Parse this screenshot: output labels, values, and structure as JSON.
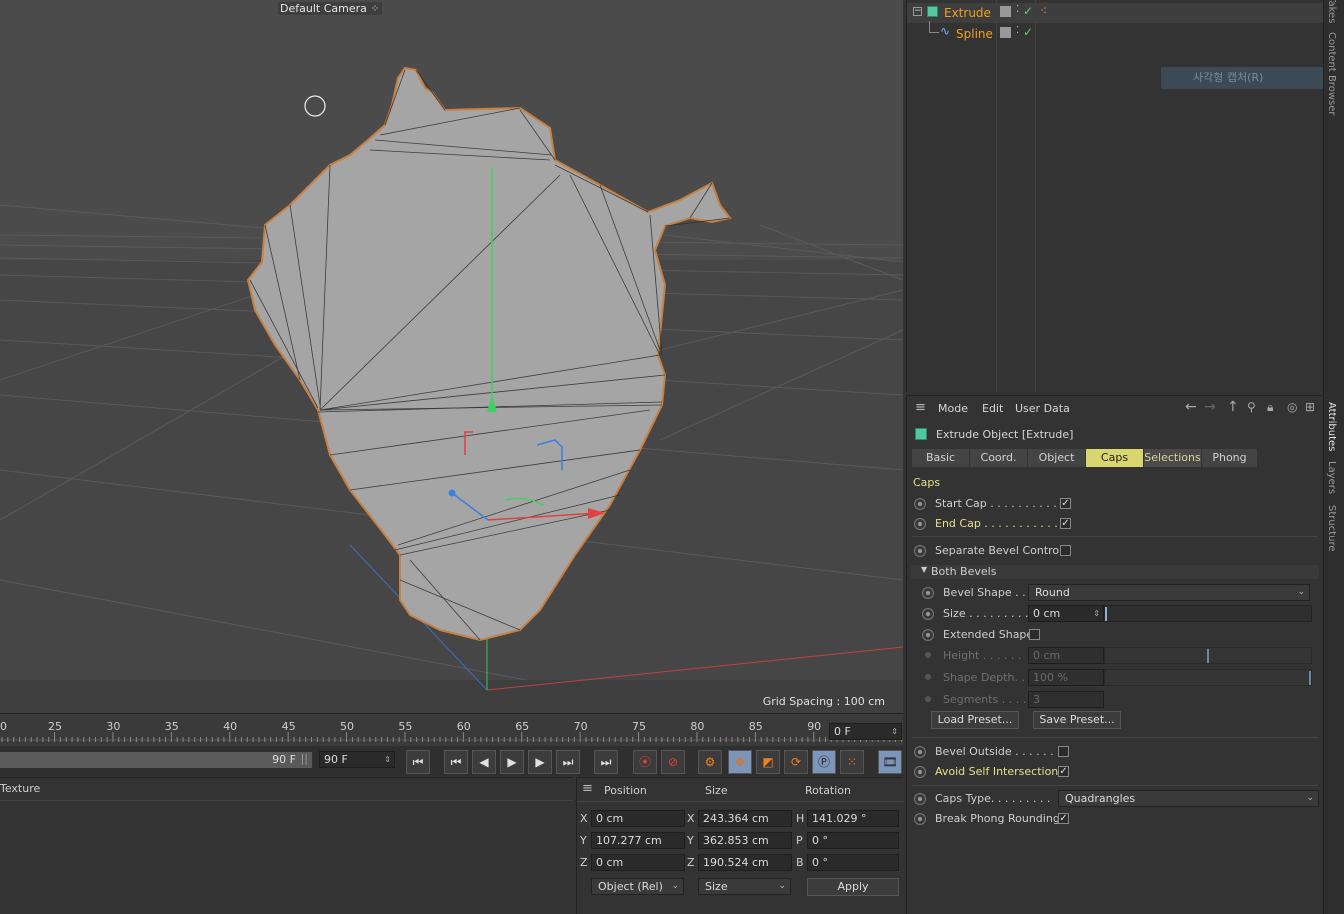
{
  "viewport": {
    "camera_label": "Default Camera",
    "grid_spacing": "Grid Spacing : 100 cm"
  },
  "object_manager": {
    "objects": [
      {
        "name": "Extrude",
        "icon": "extrude-cube-icon",
        "color": "#f0a020"
      },
      {
        "name": "Spline",
        "icon": "spline-icon",
        "color": "#f0a020"
      }
    ],
    "overlay_text": "사각형 캡처(R)"
  },
  "side_tabs": [
    "Takes",
    "Content Browser",
    "Attributes",
    "Layers",
    "Structure"
  ],
  "attributes": {
    "menu": [
      "Mode",
      "Edit",
      "User Data"
    ],
    "object_title": "Extrude Object [Extrude]",
    "tabs": [
      "Basic",
      "Coord.",
      "Object",
      "Caps",
      "Selections",
      "Phong"
    ],
    "active_tab": "Caps",
    "section_title": "Caps",
    "start_cap": "Start Cap . . . . . . . . . . .",
    "end_cap": "End Cap . . . . . . . . . . .",
    "separate_bevel": "Separate Bevel Controls",
    "both_bevels": "Both Bevels",
    "bevel_shape_label": "Bevel Shape . .",
    "bevel_shape_value": "Round",
    "size_label": "Size . . . . . . . . .",
    "size_value": "0 cm",
    "extended_shape": "Extended Shape",
    "height_label": "Height . . . . . .",
    "height_value": "0 cm",
    "shape_depth_label": "Shape Depth. .",
    "shape_depth_value": "100 %",
    "segments_label": "Segments . . . .",
    "segments_value": "3",
    "load_preset": "Load Preset...",
    "save_preset": "Save Preset...",
    "bevel_outside": "Bevel Outside . . . . . .",
    "avoid_self": "Avoid Self Intersections",
    "caps_type_label": "Caps Type. . . . . . . . .",
    "caps_type_value": "Quadrangles",
    "break_phong": "Break Phong Rounding"
  },
  "timeline": {
    "ticks": [
      "0",
      "25",
      "30",
      "35",
      "40",
      "45",
      "50",
      "55",
      "60",
      "65",
      "70",
      "75",
      "80",
      "85",
      "90"
    ],
    "current_frame": "0 F",
    "end_frame_slider": "90 F",
    "end_frame_field": "90 F"
  },
  "material_manager": {
    "label": "Texture"
  },
  "coordinates": {
    "headers": [
      "Position",
      "Size",
      "Rotation"
    ],
    "pos_x": "0 cm",
    "pos_y": "107.277 cm",
    "pos_z": "0 cm",
    "size_x": "243.364 cm",
    "size_y": "362.853 cm",
    "size_z": "190.524 cm",
    "rot_h": "141.029 °",
    "rot_p": "0 °",
    "rot_b": "0 °",
    "axis_x": "X",
    "axis_y": "Y",
    "axis_z": "Z",
    "axis_h": "H",
    "axis_p": "P",
    "axis_b": "B",
    "mode_dropdown": "Object (Rel)",
    "size_dropdown": "Size",
    "apply": "Apply"
  }
}
